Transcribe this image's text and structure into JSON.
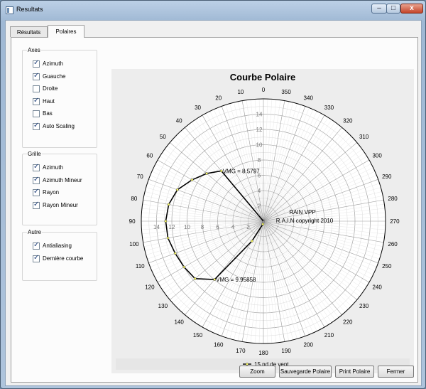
{
  "window": {
    "title": "Resultats"
  },
  "window_controls": {
    "minimize": "–",
    "maximize": "□",
    "close": "x"
  },
  "tabs": [
    {
      "label": "Résultats"
    },
    {
      "label": "Polaires"
    }
  ],
  "panel": {
    "axes": {
      "title": "Axes",
      "items": [
        {
          "label": "Azimuth",
          "checked": true
        },
        {
          "label": "Guauche",
          "checked": true
        },
        {
          "label": "Droite",
          "checked": false
        },
        {
          "label": "Haut",
          "checked": true
        },
        {
          "label": "Bas",
          "checked": false
        },
        {
          "label": "Auto Scaling",
          "checked": true
        }
      ]
    },
    "grille": {
      "title": "Grille",
      "items": [
        {
          "label": "Azimuth",
          "checked": true
        },
        {
          "label": "Azimuth Mineur",
          "checked": true
        },
        {
          "label": "Rayon",
          "checked": true
        },
        {
          "label": "Rayon Mineur",
          "checked": true
        }
      ]
    },
    "autre": {
      "title": "Autre",
      "items": [
        {
          "label": "Antialiasing",
          "checked": true
        },
        {
          "label": "Dernière courbe",
          "checked": true
        }
      ]
    }
  },
  "chart_data": {
    "type": "polar-line",
    "title": "Courbe Polaire",
    "angle_ticks": [
      0,
      10,
      20,
      30,
      40,
      50,
      60,
      70,
      80,
      90,
      100,
      110,
      120,
      130,
      140,
      150,
      160,
      170,
      180,
      190,
      200,
      210,
      220,
      230,
      240,
      250,
      260,
      270,
      280,
      290,
      300,
      310,
      320,
      330,
      340,
      350
    ],
    "radial_range": [
      0,
      16
    ],
    "radial_ticks": [
      0,
      2,
      4,
      6,
      8,
      10,
      12,
      14
    ],
    "series": [
      {
        "name": "15 nd de vent",
        "color": "#000000",
        "points": [
          {
            "angle": 0,
            "r": 0
          },
          {
            "angle": 40,
            "r": 8.58
          },
          {
            "angle": 50,
            "r": 9.7
          },
          {
            "angle": 60,
            "r": 10.8
          },
          {
            "angle": 70,
            "r": 12.0
          },
          {
            "angle": 80,
            "r": 12.6
          },
          {
            "angle": 90,
            "r": 12.8
          },
          {
            "angle": 100,
            "r": 12.7
          },
          {
            "angle": 110,
            "r": 12.3
          },
          {
            "angle": 120,
            "r": 12.0
          },
          {
            "angle": 130,
            "r": 11.7
          },
          {
            "angle": 140,
            "r": 9.96
          },
          {
            "angle": 150,
            "r": 3.0
          },
          {
            "angle": 170,
            "r": 0.4
          }
        ]
      }
    ],
    "annotations": [
      {
        "text": "VMG = 8.5797",
        "angle": 40,
        "r": 8.58
      },
      {
        "text": "VMG = 9.95858",
        "angle": 140,
        "r": 9.96
      }
    ],
    "watermark": [
      "RAIN VPP",
      "R.A.I.N copyright 2010"
    ],
    "legend": {
      "position": "bottom",
      "label": "15 nd de vent"
    },
    "grid": true
  },
  "buttons": {
    "zoom": "Zoom",
    "save": "Sauvegarde Polaire",
    "print": "Print Polaire",
    "close": "Fermer"
  }
}
